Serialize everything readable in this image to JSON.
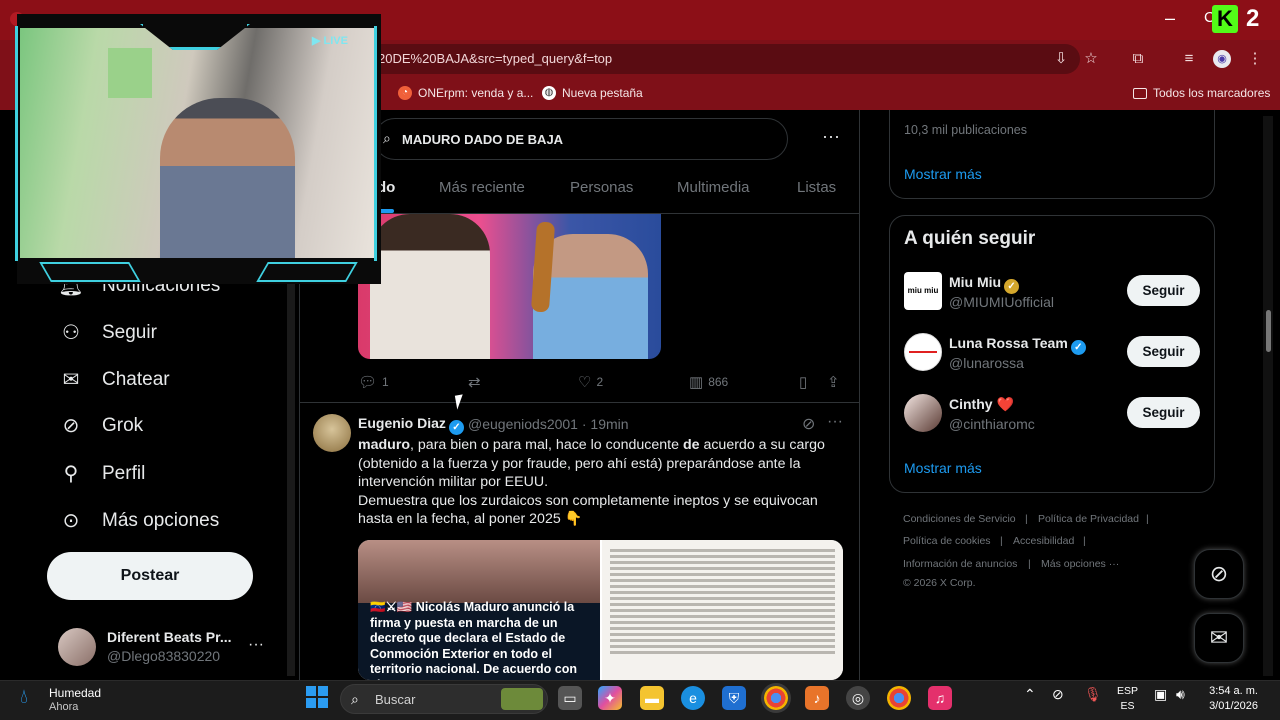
{
  "browser": {
    "url": "20DE%20BAJA&src=typed_query&f=top",
    "bookmarks": [
      {
        "label": "ONErpm: venda y a..."
      },
      {
        "label": "Nueva pestaña"
      }
    ],
    "all_bookmarks": "Todos los marcadores",
    "kick_count": "2"
  },
  "overlay": {
    "live": "LIVE"
  },
  "sidebar": {
    "items": [
      {
        "label": "Notificaciones"
      },
      {
        "label": "Seguir"
      },
      {
        "label": "Chatear"
      },
      {
        "label": "Grok"
      },
      {
        "label": "Perfil"
      },
      {
        "label": "Más opciones"
      }
    ],
    "post_label": "Postear",
    "account": {
      "name": "Diferent Beats Pr...",
      "handle": "@Dlego83830220"
    }
  },
  "search": {
    "query": "MADURO DADO DE BAJA"
  },
  "tabs": [
    {
      "label": "do"
    },
    {
      "label": "Más reciente"
    },
    {
      "label": "Personas"
    },
    {
      "label": "Multimedia"
    },
    {
      "label": "Listas"
    }
  ],
  "tweet1": {
    "replies": "1",
    "likes": "2",
    "views": "866"
  },
  "tweet2": {
    "name": "Eugenio Diaz",
    "handle": "@eugeniods2001 · 19min",
    "body_bold1": "maduro",
    "body1": ", para bien o para mal, hace lo conducente ",
    "body_bold2": "de",
    "body2": " acuerdo a su cargo (obtenido a la fuerza y por fraude, pero ahí está) preparándose ante la intervención militar por EEUU.",
    "body3": "Demuestra que los zurdaicos son completamente ineptos y se equivocan hasta en la fecha, al poner 2025 👇",
    "media_caption": "🇻🇪⚔🇺🇸 Nicolás Maduro anunció la firma y puesta en marcha de un decreto que declara el Estado de Conmoción Exterior en todo el territorio nacional. De acuerdo con el"
  },
  "trends": {
    "count": "10,3 mil publicaciones",
    "show_more": "Mostrar más"
  },
  "who_to_follow": {
    "title": "A quién seguir",
    "users": [
      {
        "name": "Miu Miu",
        "handle": "@MIUMIUofficial",
        "logo": "miu miu",
        "badge": "gold"
      },
      {
        "name": "Luna Rossa Team",
        "handle": "@lunarossa",
        "badge": "blue"
      },
      {
        "name": "Cinthy ❤️",
        "handle": "@cinthiaromc",
        "badge": "none"
      }
    ],
    "follow_label": "Seguir",
    "show_more": "Mostrar más"
  },
  "footer": {
    "links": [
      "Condiciones de Servicio",
      "|",
      "Política de Privacidad",
      "|",
      "Política de cookies",
      "|",
      "Accesibilidad",
      "|",
      "Información de anuncios",
      "|",
      "Más opciones ···"
    ],
    "copyright": "© 2026 X Corp."
  },
  "taskbar": {
    "weather_title": "Humedad",
    "weather_sub": "Ahora",
    "search_placeholder": "Buscar",
    "lang_top": "ESP",
    "lang_bottom": "ES",
    "time": "3:54 a. m.",
    "date": "3/01/2026"
  },
  "colors": {
    "accent": "#1d9bf0",
    "browser_frame": "#8c0f17",
    "kick": "#53fc18",
    "overlay_frame": "#3fd0e0"
  }
}
